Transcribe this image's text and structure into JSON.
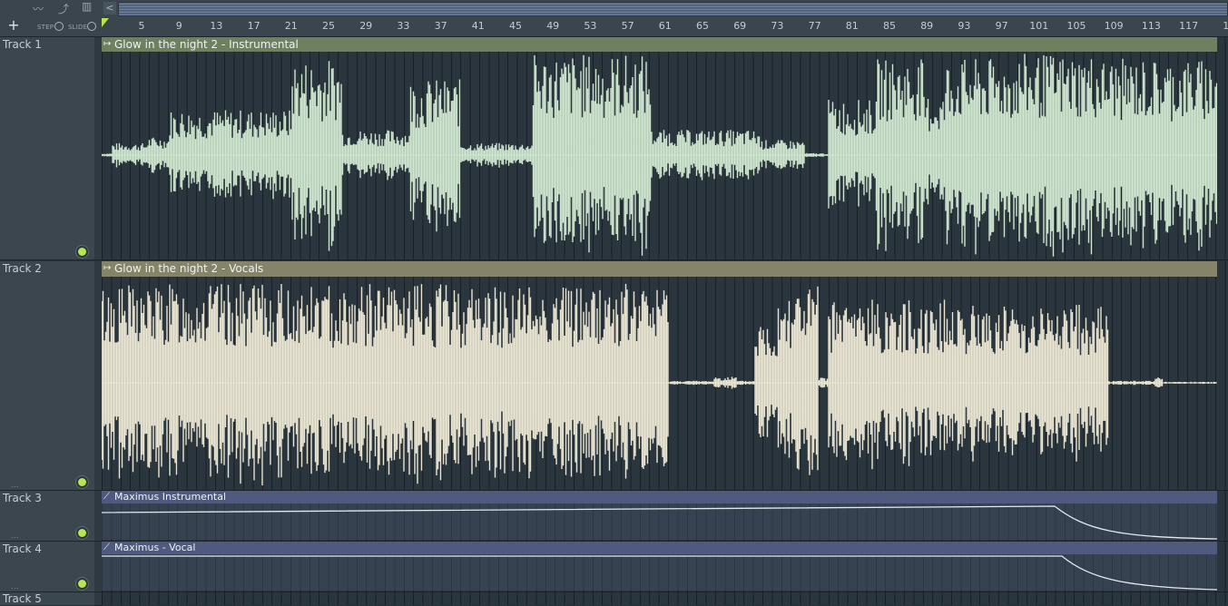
{
  "toolbar": {
    "add_label": "+",
    "step_label": "STEP",
    "slide_label": "SLIDE"
  },
  "ruler": {
    "scroll_left": "<",
    "bars": [
      "5",
      "9",
      "13",
      "17",
      "21",
      "25",
      "29",
      "33",
      "37",
      "41",
      "45",
      "49",
      "53",
      "57",
      "61",
      "65",
      "69",
      "73",
      "77",
      "81",
      "85",
      "89",
      "93",
      "97",
      "101",
      "105",
      "109",
      "113",
      "117",
      "1"
    ]
  },
  "tracks": [
    {
      "name": "Track 1",
      "clip": "Glow in the night 2 - Instrumental",
      "type": "audio",
      "color": "#6f8060",
      "wave_color": "#cfe6cf"
    },
    {
      "name": "Track 2",
      "clip": "Glow in the night 2 - Vocals",
      "type": "audio",
      "color": "#858468",
      "wave_color": "#ebe6d3"
    },
    {
      "name": "Track 3",
      "clip": "Maximus Instrumental",
      "type": "automation",
      "color": "#4f5a7e"
    },
    {
      "name": "Track 4",
      "clip": "Maximus - Vocal",
      "type": "automation",
      "color": "#4f5a7e"
    },
    {
      "name": "Track 5"
    }
  ],
  "icons": {
    "plus": "plus-icon",
    "waveform": "waveform-icon",
    "pencil": "automation-curve-icon",
    "piano": "piano-icon",
    "audio_clip": "audio-clip-icon",
    "automation_clip": "automation-clip-icon"
  }
}
